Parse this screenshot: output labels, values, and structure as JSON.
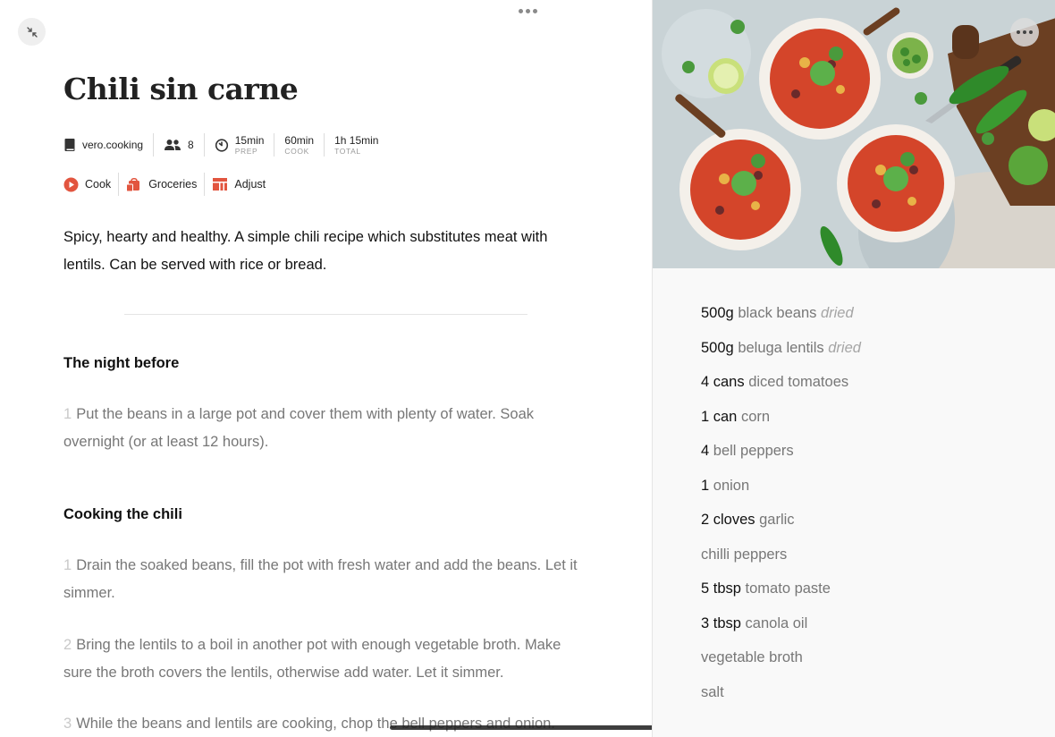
{
  "recipe": {
    "title": "Chili sin carne",
    "source": "vero.cooking",
    "servings": "8",
    "times": [
      {
        "value": "15min",
        "label": "PREP"
      },
      {
        "value": "60min",
        "label": "COOK"
      },
      {
        "value": "1h 15min",
        "label": "TOTAL"
      }
    ],
    "actions": [
      {
        "label": "Cook",
        "icon": "play-circle-icon"
      },
      {
        "label": "Groceries",
        "icon": "grocery-bag-icon"
      },
      {
        "label": "Adjust",
        "icon": "scale-icon"
      }
    ],
    "description": "Spicy, hearty and healthy. A simple chili recipe which substitutes meat with lentils. Can be served with rice or bread.",
    "sections": [
      {
        "title": "The night before",
        "steps": [
          {
            "num": "1",
            "text": "Put the beans in a large pot and cover them with plenty of water. Soak overnight (or at least 12 hours)."
          }
        ]
      },
      {
        "title": "Cooking the chili",
        "steps": [
          {
            "num": "1",
            "text": "Drain the soaked beans, fill the pot with fresh water and add the beans. Let it simmer."
          },
          {
            "num": "2",
            "text": "Bring the lentils to a boil in another pot with enough vegetable broth. Make sure the broth covers the lentils, otherwise add water. Let it simmer."
          },
          {
            "num": "3",
            "text": "While the beans and lentils are cooking, chop the bell peppers and onion."
          }
        ]
      }
    ]
  },
  "ingredients": [
    {
      "qty": "500g",
      "name": "black beans",
      "note": "dried"
    },
    {
      "qty": "500g",
      "name": "beluga lentils",
      "note": "dried"
    },
    {
      "qty": "4 cans",
      "name": "diced tomatoes",
      "note": ""
    },
    {
      "qty": "1 can",
      "name": "corn",
      "note": ""
    },
    {
      "qty": "4",
      "name": "bell peppers",
      "note": ""
    },
    {
      "qty": "1",
      "name": "onion",
      "note": ""
    },
    {
      "qty": "2 cloves",
      "name": "garlic",
      "note": ""
    },
    {
      "qty": "",
      "name": "chilli peppers",
      "note": ""
    },
    {
      "qty": "5 tbsp",
      "name": "tomato paste",
      "note": ""
    },
    {
      "qty": "3 tbsp",
      "name": "canola oil",
      "note": ""
    },
    {
      "qty": "",
      "name": "vegetable broth",
      "note": ""
    },
    {
      "qty": "",
      "name": "salt",
      "note": ""
    }
  ],
  "colors": {
    "accent": "#e2553f",
    "text": "#111111",
    "muted": "#777777",
    "sidebar_bg": "#f9f9f9"
  }
}
